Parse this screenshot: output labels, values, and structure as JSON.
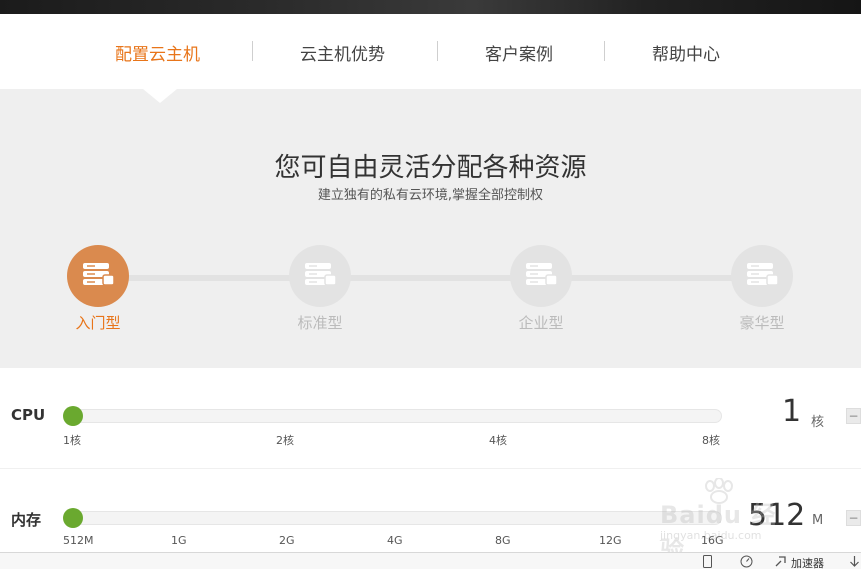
{
  "nav": {
    "items": [
      {
        "label": "配置云主机",
        "active": true
      },
      {
        "label": "云主机优势",
        "active": false
      },
      {
        "label": "客户案例",
        "active": false
      },
      {
        "label": "帮助中心",
        "active": false
      }
    ]
  },
  "config": {
    "title": "您可自由灵活分配各种资源",
    "subtitle": "建立独有的私有云环境,掌握全部控制权",
    "tiers": [
      {
        "label": "入门型",
        "icon": "server-stack-icon",
        "active": true
      },
      {
        "label": "标准型",
        "icon": "server-stack-icon",
        "active": false
      },
      {
        "label": "企业型",
        "icon": "server-stack-icon",
        "active": false
      },
      {
        "label": "豪华型",
        "icon": "server-stack-icon",
        "active": false
      }
    ]
  },
  "cpu": {
    "label": "CPU",
    "ticks": [
      "1核",
      "2核",
      "4核",
      "8核"
    ],
    "value": "1",
    "unit": "核",
    "slider_fraction": 0
  },
  "memory": {
    "label": "内存",
    "ticks": [
      "512M",
      "1G",
      "2G",
      "4G",
      "8G",
      "12G",
      "16G"
    ],
    "value": "512",
    "unit": "M",
    "slider_fraction": 0
  },
  "watermark": {
    "main": "Baidu 经验",
    "sub": "jingyan.baidu.com"
  },
  "statusbar": {
    "accelerator_label": "加速器"
  },
  "colors": {
    "accent": "#e8751a",
    "tier_active": "#da8a4e",
    "slider_knob": "#6aa92f"
  }
}
